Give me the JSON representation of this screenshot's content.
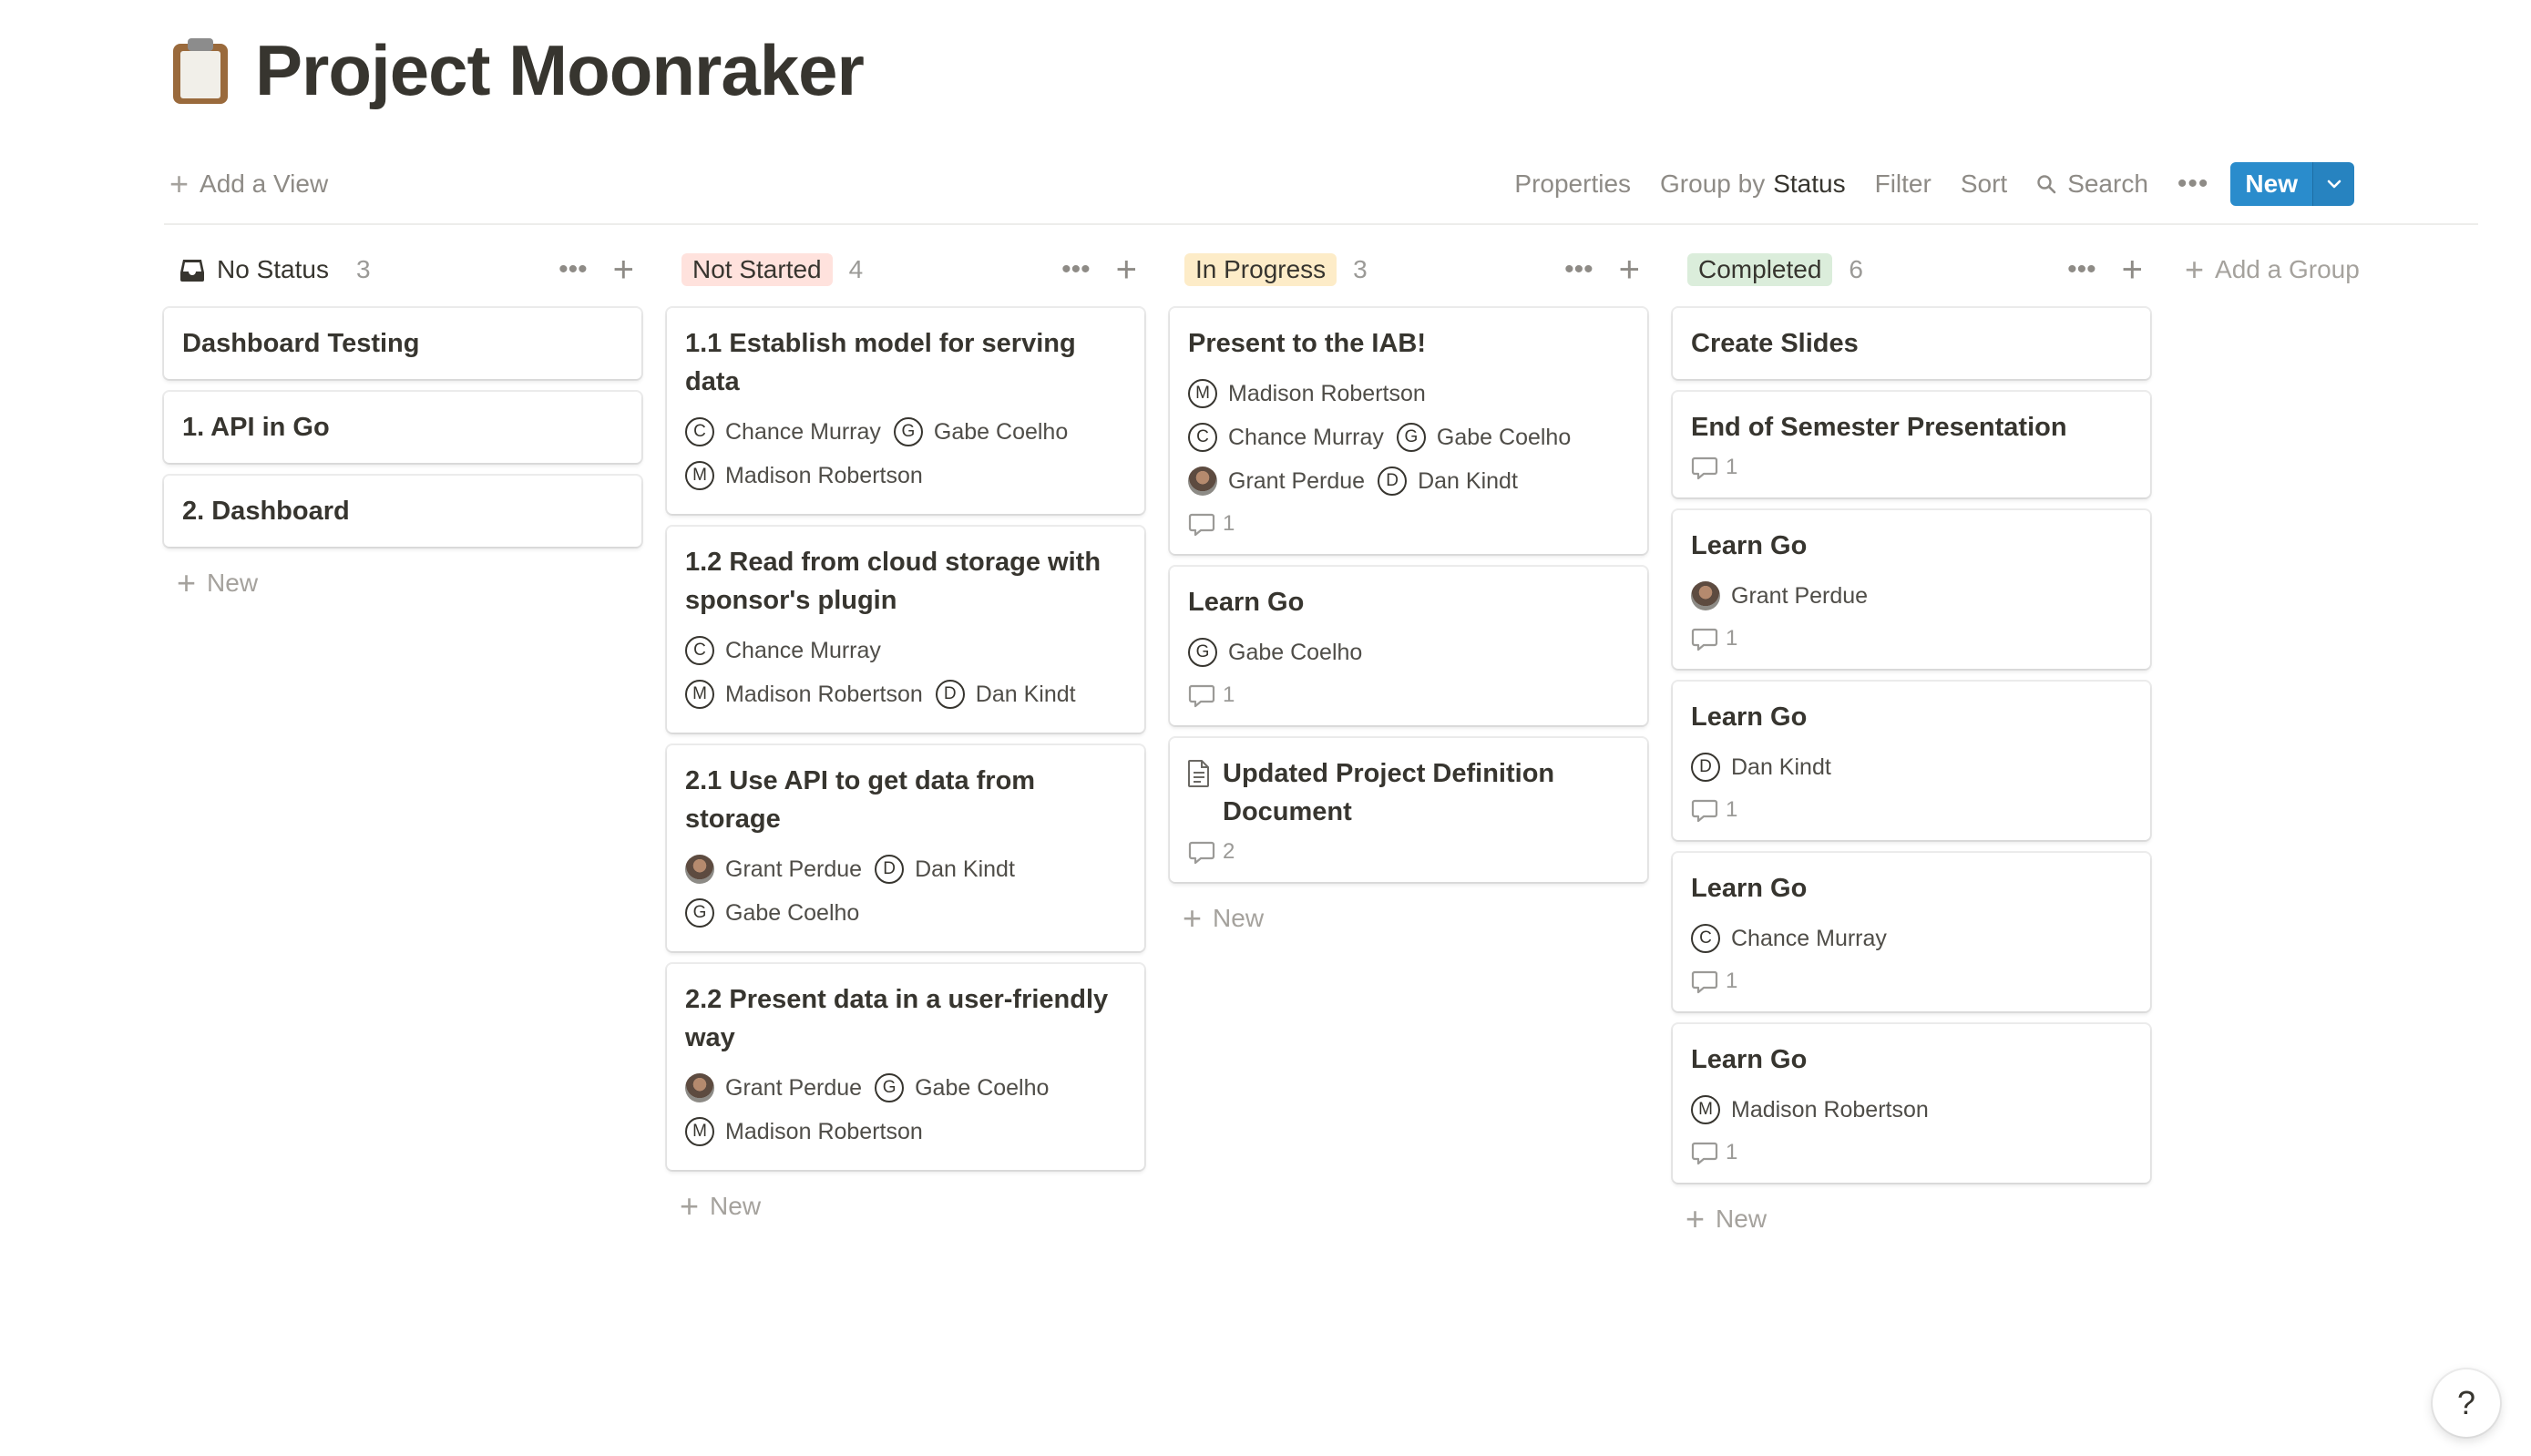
{
  "page": {
    "title": "Project Moonraker",
    "icon": "clipboard-icon"
  },
  "toolbar": {
    "add_view": "Add a View",
    "properties": "Properties",
    "group_by": "Group by",
    "group_by_value": "Status",
    "filter": "Filter",
    "sort": "Sort",
    "search": "Search",
    "new": "New"
  },
  "colors": {
    "accent": "#2a8ccc",
    "not_started": "#ffe2dd",
    "in_progress": "#fdecc8",
    "completed": "#dbeddb"
  },
  "columns": [
    {
      "label": "No Status",
      "count": "3",
      "color": "",
      "cards": [
        {
          "title": "Dashboard Testing",
          "people": [],
          "comments": ""
        },
        {
          "title": "1. API in Go",
          "people": [],
          "comments": ""
        },
        {
          "title": "2. Dashboard",
          "people": [],
          "comments": ""
        }
      ],
      "new_label": "New"
    },
    {
      "label": "Not Started",
      "count": "4",
      "color": "#ffe2dd",
      "cards": [
        {
          "title": "1.1 Establish model for serving data",
          "people": [
            {
              "name": "Chance Murray",
              "initial": "C"
            },
            {
              "name": "Gabe Coelho",
              "initial": "G"
            },
            {
              "name": "Madison Robertson",
              "initial": "M"
            }
          ],
          "comments": ""
        },
        {
          "title": "1.2 Read from cloud storage with sponsor's plugin",
          "people": [
            {
              "name": "Chance Murray",
              "initial": "C"
            },
            {
              "name": "Madison Robertson",
              "initial": "M"
            },
            {
              "name": "Dan Kindt",
              "initial": "D"
            }
          ],
          "comments": ""
        },
        {
          "title": "2.1 Use API to get data from storage",
          "people": [
            {
              "name": "Grant Perdue",
              "initial": "",
              "photo": true
            },
            {
              "name": "Dan Kindt",
              "initial": "D"
            },
            {
              "name": "Gabe Coelho",
              "initial": "G"
            }
          ],
          "comments": ""
        },
        {
          "title": "2.2 Present data in a user-friendly way",
          "people": [
            {
              "name": "Grant Perdue",
              "initial": "",
              "photo": true
            },
            {
              "name": "Gabe Coelho",
              "initial": "G"
            },
            {
              "name": "Madison Robertson",
              "initial": "M"
            }
          ],
          "comments": ""
        }
      ],
      "new_label": "New"
    },
    {
      "label": "In Progress",
      "count": "3",
      "color": "#fdecc8",
      "cards": [
        {
          "title": "Present to the IAB!",
          "people": [
            {
              "name": "Madison Robertson",
              "initial": "M"
            },
            {
              "name": "Chance Murray",
              "initial": "C"
            },
            {
              "name": "Gabe Coelho",
              "initial": "G"
            },
            {
              "name": "Grant Perdue",
              "initial": "",
              "photo": true
            },
            {
              "name": "Dan Kindt",
              "initial": "D"
            }
          ],
          "comments": "1"
        },
        {
          "title": "Learn Go",
          "people": [
            {
              "name": "Gabe Coelho",
              "initial": "G"
            }
          ],
          "comments": "1"
        },
        {
          "title": "Updated Project Definition Document",
          "doc": true,
          "people": [],
          "comments": "2"
        }
      ],
      "new_label": "New"
    },
    {
      "label": "Completed",
      "count": "6",
      "color": "#dbeddb",
      "cards": [
        {
          "title": "Create Slides",
          "people": [],
          "comments": ""
        },
        {
          "title": "End of Semester Presentation",
          "people": [],
          "comments": "1"
        },
        {
          "title": "Learn Go",
          "people": [
            {
              "name": "Grant Perdue",
              "initial": "",
              "photo": true
            }
          ],
          "comments": "1"
        },
        {
          "title": "Learn Go",
          "people": [
            {
              "name": "Dan Kindt",
              "initial": "D"
            }
          ],
          "comments": "1"
        },
        {
          "title": "Learn Go",
          "people": [
            {
              "name": "Chance Murray",
              "initial": "C"
            }
          ],
          "comments": "1"
        },
        {
          "title": "Learn Go",
          "people": [
            {
              "name": "Madison Robertson",
              "initial": "M"
            }
          ],
          "comments": "1"
        }
      ],
      "new_label": "New"
    }
  ],
  "add_group": "Add a Group",
  "help": "?"
}
